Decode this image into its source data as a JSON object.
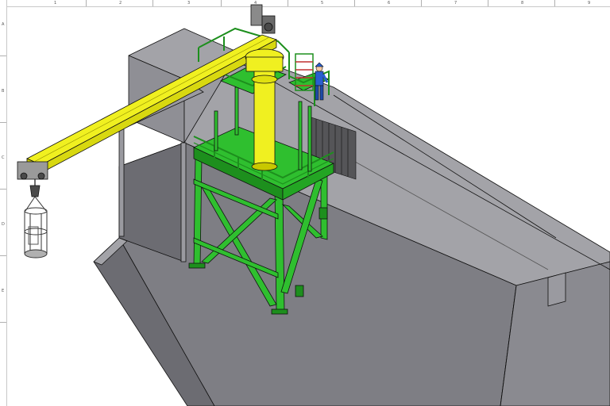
{
  "drawing": {
    "top_ruler_labels": [
      "1",
      "2",
      "3",
      "4",
      "5",
      "6",
      "7",
      "8",
      "9"
    ],
    "left_ruler_labels": [
      "A",
      "B",
      "C",
      "D",
      "E"
    ]
  },
  "colors": {
    "background": "#ffffff",
    "concrete_top": "#a3a3a8",
    "concrete_front": "#7e7e84",
    "concrete_side": "#8f8f95",
    "concrete_dark": "#6c6c72",
    "steel_green": "#2fbf2f",
    "steel_green_dark": "#1d8f1d",
    "jib_yellow": "#f0f020",
    "jib_yellow_dark": "#c8c800",
    "worker_blue": "#2a5fd0",
    "cage_gray": "#8a8a8a",
    "edge_black": "#111111"
  }
}
